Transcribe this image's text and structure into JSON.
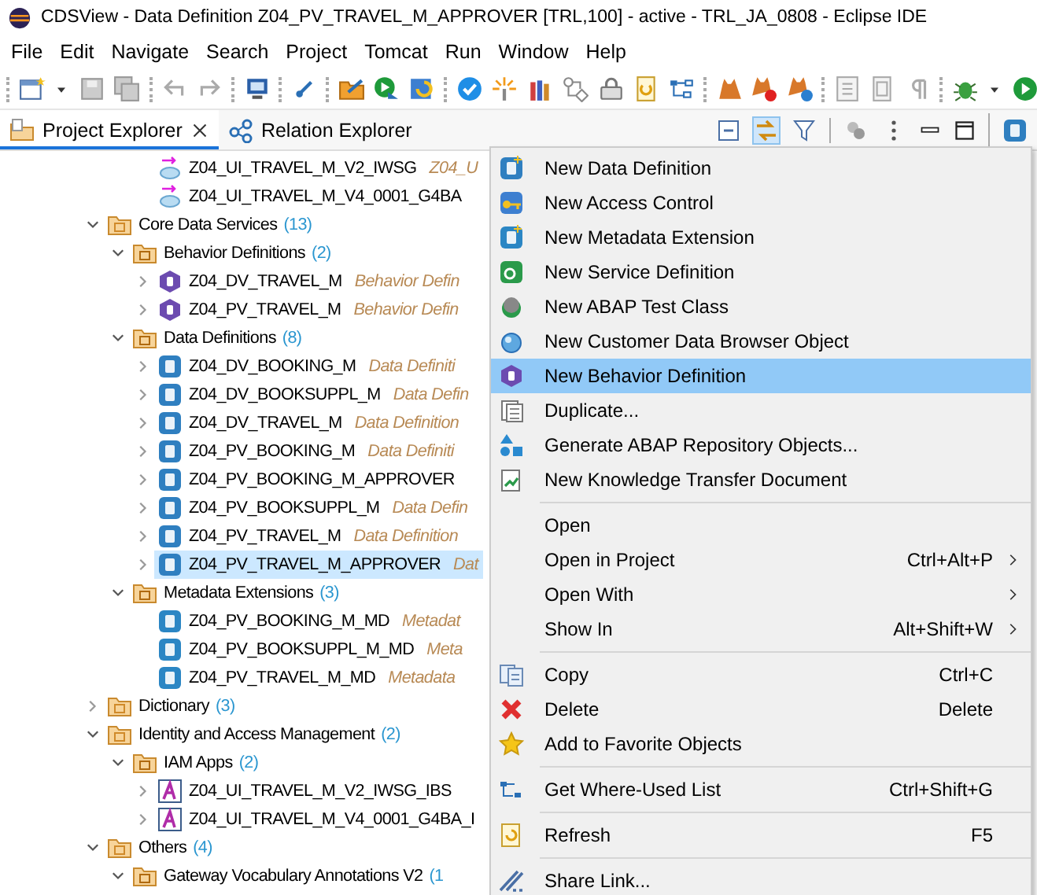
{
  "window": {
    "title": "CDSView - Data Definition Z04_PV_TRAVEL_M_APPROVER [TRL,100] - active - TRL_JA_0808 - Eclipse IDE"
  },
  "menu_bar": [
    "File",
    "Edit",
    "Navigate",
    "Search",
    "Project",
    "Tomcat",
    "Run",
    "Window",
    "Help"
  ],
  "view_tabs": [
    {
      "label": "Project Explorer",
      "selected": true,
      "closable": true
    },
    {
      "label": "Relation Explorer",
      "selected": false,
      "closable": false
    }
  ],
  "tree": {
    "continued_items": [
      {
        "kind": "service-binding",
        "label": "Z04_UI_TRAVEL_M_V2_IWSG",
        "description": "Z04_U",
        "selected": false
      },
      {
        "kind": "service-binding",
        "label": "Z04_UI_TRAVEL_M_V4_0001_G4BA",
        "selected": false
      }
    ],
    "items": [
      {
        "kind": "group",
        "label": "Core Data Services",
        "count": "(13)",
        "expanded": true,
        "selected": false,
        "children": [
          {
            "kind": "type-folder",
            "label": "Behavior Definitions",
            "count": "(2)",
            "expanded": true,
            "selected": false,
            "children": [
              {
                "kind": "behavior",
                "label": "Z04_DV_TRAVEL_M",
                "description": "Behavior Defin",
                "expanded": false,
                "selected": false
              },
              {
                "kind": "behavior",
                "label": "Z04_PV_TRAVEL_M",
                "description": "Behavior Defin",
                "expanded": false,
                "selected": false
              }
            ]
          },
          {
            "kind": "type-folder",
            "label": "Data Definitions",
            "count": "(8)",
            "expanded": true,
            "selected": false,
            "children": [
              {
                "kind": "data-definition",
                "label": "Z04_DV_BOOKING_M",
                "description": "Data Definiti",
                "expanded": false,
                "selected": false
              },
              {
                "kind": "data-definition",
                "label": "Z04_DV_BOOKSUPPL_M",
                "description": "Data Defin",
                "expanded": false,
                "selected": false
              },
              {
                "kind": "data-definition",
                "label": "Z04_DV_TRAVEL_M",
                "description": "Data Definition",
                "expanded": false,
                "selected": false
              },
              {
                "kind": "data-definition",
                "label": "Z04_PV_BOOKING_M",
                "description": "Data Definiti",
                "expanded": false,
                "selected": false
              },
              {
                "kind": "data-definition",
                "label": "Z04_PV_BOOKING_M_APPROVER",
                "expanded": false,
                "selected": false
              },
              {
                "kind": "data-definition",
                "label": "Z04_PV_BOOKSUPPL_M",
                "description": "Data Defin",
                "expanded": false,
                "selected": false
              },
              {
                "kind": "data-definition",
                "label": "Z04_PV_TRAVEL_M",
                "description": "Data Definition",
                "expanded": false,
                "selected": false
              },
              {
                "kind": "data-definition",
                "label": "Z04_PV_TRAVEL_M_APPROVER",
                "description": "Dat",
                "expanded": false,
                "selected": true
              }
            ]
          },
          {
            "kind": "type-folder",
            "label": "Metadata Extensions",
            "count": "(3)",
            "expanded": true,
            "selected": false,
            "children": [
              {
                "kind": "metadata-extension",
                "label": "Z04_PV_BOOKING_M_MD",
                "description": "Metadat",
                "selected": false
              },
              {
                "kind": "metadata-extension",
                "label": "Z04_PV_BOOKSUPPL_M_MD",
                "description": "Meta",
                "selected": false
              },
              {
                "kind": "metadata-extension",
                "label": "Z04_PV_TRAVEL_M_MD",
                "description": "Metadata",
                "selected": false
              }
            ]
          }
        ]
      },
      {
        "kind": "group",
        "label": "Dictionary",
        "count": "(3)",
        "expanded": false,
        "selected": false
      },
      {
        "kind": "group",
        "label": "Identity and Access Management",
        "count": "(2)",
        "expanded": true,
        "selected": false,
        "children": [
          {
            "kind": "type-folder",
            "label": "IAM Apps",
            "count": "(2)",
            "expanded": true,
            "selected": false,
            "children": [
              {
                "kind": "iam-app",
                "label": "Z04_UI_TRAVEL_M_V2_IWSG_IBS",
                "expanded": false,
                "selected": false
              },
              {
                "kind": "iam-app",
                "label": "Z04_UI_TRAVEL_M_V4_0001_G4BA_I",
                "expanded": false,
                "selected": false
              }
            ]
          }
        ]
      },
      {
        "kind": "group",
        "label": "Others",
        "count": "(4)",
        "expanded": true,
        "selected": false,
        "children": [
          {
            "kind": "type-folder",
            "label": "Gateway Vocabulary Annotations V2",
            "count": "(1",
            "expanded": true,
            "selected": false
          }
        ]
      }
    ]
  },
  "context_menu": {
    "items": [
      {
        "kind": "item",
        "label": "New Data Definition",
        "selected": false
      },
      {
        "kind": "item",
        "label": "New Access Control",
        "selected": false
      },
      {
        "kind": "item",
        "label": "New Metadata Extension",
        "selected": false
      },
      {
        "kind": "item",
        "label": "New Service Definition",
        "selected": false
      },
      {
        "kind": "item",
        "label": "New ABAP Test Class",
        "selected": false
      },
      {
        "kind": "item",
        "label": "New Customer Data Browser Object",
        "selected": false
      },
      {
        "kind": "item",
        "label": "New Behavior Definition",
        "selected": true
      },
      {
        "kind": "item",
        "label": "Duplicate...",
        "selected": false
      },
      {
        "kind": "item",
        "label": "Generate ABAP Repository Objects...",
        "selected": false
      },
      {
        "kind": "item",
        "label": "New Knowledge Transfer Document",
        "selected": false
      },
      {
        "kind": "separator"
      },
      {
        "kind": "item",
        "label": "Open",
        "selected": false
      },
      {
        "kind": "item",
        "label": "Open in Project",
        "shortcut": "Ctrl+Alt+P",
        "submenu": true,
        "selected": false
      },
      {
        "kind": "item",
        "label": "Open With",
        "submenu": true,
        "selected": false
      },
      {
        "kind": "item",
        "label": "Show In",
        "shortcut": "Alt+Shift+W",
        "submenu": true,
        "selected": false
      },
      {
        "kind": "separator"
      },
      {
        "kind": "item",
        "label": "Copy",
        "shortcut": "Ctrl+C",
        "selected": false
      },
      {
        "kind": "item",
        "label": "Delete",
        "shortcut": "Delete",
        "selected": false
      },
      {
        "kind": "item",
        "label": "Add to Favorite Objects",
        "selected": false
      },
      {
        "kind": "separator"
      },
      {
        "kind": "item",
        "label": "Get Where-Used List",
        "shortcut": "Ctrl+Shift+G",
        "selected": false
      },
      {
        "kind": "separator"
      },
      {
        "kind": "item",
        "label": "Refresh",
        "shortcut": "F5",
        "selected": false
      },
      {
        "kind": "separator"
      },
      {
        "kind": "item",
        "label": "Share Link...",
        "selected": false
      }
    ]
  }
}
